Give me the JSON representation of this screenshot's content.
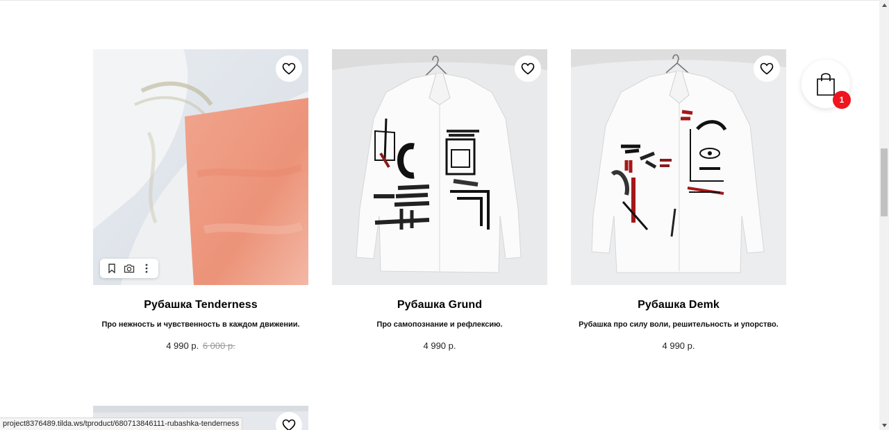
{
  "status_url": "project8376489.tilda.ws/tproduct/680713846111-rubashka-tenderness",
  "cart": {
    "count": "1",
    "icon": "shopping-bag-icon",
    "badge_color": "#f0141e"
  },
  "products": [
    {
      "title": "Рубашка Tenderness",
      "description": "Про нежность и чувственность в каждом движении.",
      "price": "4 990 р.",
      "old_price": "6 000 р.",
      "image_palette": [
        "#dfe4ea",
        "#ee9a82",
        "#b8b59a"
      ]
    },
    {
      "title": "Рубашка Grund",
      "description": "Про самопознание и рефлексию.",
      "price": "4 990 р.",
      "old_price": ""
    },
    {
      "title": "Рубашка Demk",
      "description": "Рубашка про силу воли, решительность и упорство.",
      "price": "4 990 р.",
      "old_price": ""
    }
  ],
  "image_tools": [
    "bookmark-icon",
    "camera-icon",
    "more-vertical-icon"
  ]
}
